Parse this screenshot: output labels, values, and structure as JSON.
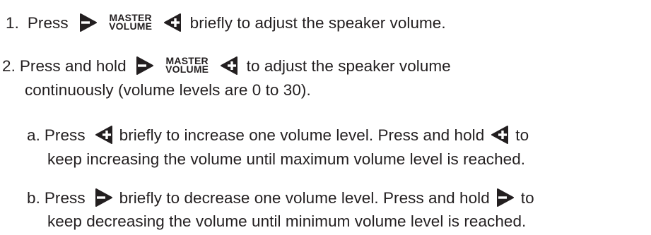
{
  "steps": {
    "step1": {
      "number": "1.",
      "press": "Press",
      "rest": "briefly to adjust the speaker volume."
    },
    "step2": {
      "number": "2.",
      "press_hold": "Press and hold",
      "rest": "to adjust the speaker volume",
      "cont": "continuously (volume levels are 0 to 30)."
    },
    "sub_a": {
      "letter": "a.",
      "press": "Press",
      "mid": "briefly to increase one volume level. Press and hold",
      "to": "to",
      "cont": "keep increasing the volume until maximum volume level is reached."
    },
    "sub_b": {
      "letter": "b.",
      "press": "Press",
      "mid": "briefly to decrease one volume level. Press and hold",
      "to": "to",
      "cont": "keep decreasing the volume until minimum volume level is reached."
    }
  },
  "key_label": {
    "line1": "MASTER",
    "line2": "VOLUME"
  },
  "icons": {
    "minus": "volume-down-icon",
    "plus": "volume-up-icon",
    "color": "#231f20"
  }
}
